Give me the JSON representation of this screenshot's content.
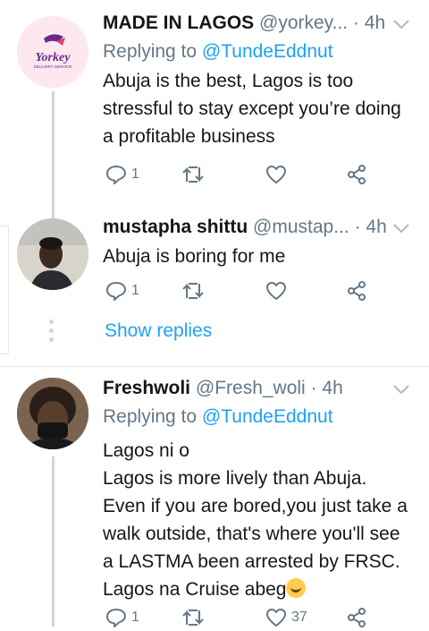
{
  "tweets": [
    {
      "name": "MADE IN LAGOS",
      "handle": "@yorkey...",
      "time": "· 4h",
      "replying_label": "Replying to",
      "replying_user": "@TundeEddnut",
      "text": "Abuja is the best, Lagos is too stressful to stay except you’re doing a profitable business",
      "logo_text": "Yorkey",
      "logo_subtext": "DELIVERY SERVICE",
      "reply_count": "1",
      "retweet_count": "",
      "like_count": ""
    },
    {
      "name": "mustapha shittu",
      "handle": "@mustap...",
      "time": "· 4h",
      "text": "Abuja is boring for me",
      "reply_count": "1",
      "retweet_count": "",
      "like_count": ""
    },
    {
      "name": "Freshwoli",
      "handle": "@Fresh_woli",
      "time": "· 4h",
      "replying_label": "Replying to",
      "replying_user": "@TundeEddnut",
      "lines": [
        "Lagos ni o",
        "Lagos is more lively than Abuja.",
        "Even if you are bored,you just take a",
        "walk outside, that's where you'll see",
        "a LASTMA been arrested by FRSC.",
        "Lagos na Cruise abeg"
      ],
      "reply_count": "1",
      "retweet_count": "",
      "like_count": "37"
    }
  ],
  "show_replies_label": "Show replies",
  "icons": {
    "reply": "reply-icon",
    "retweet": "retweet-icon",
    "like": "heart-icon",
    "share": "share-icon",
    "caret": "chevron-down-icon",
    "emoji": "rolling-laughing-emoji"
  },
  "colors": {
    "link": "#1da1f2",
    "secondary_text": "#657786",
    "primary_text": "#14171a",
    "divider": "#e1e8ed",
    "logo_purple": "#6a2a8c",
    "logo_pink": "#fde8ef"
  }
}
